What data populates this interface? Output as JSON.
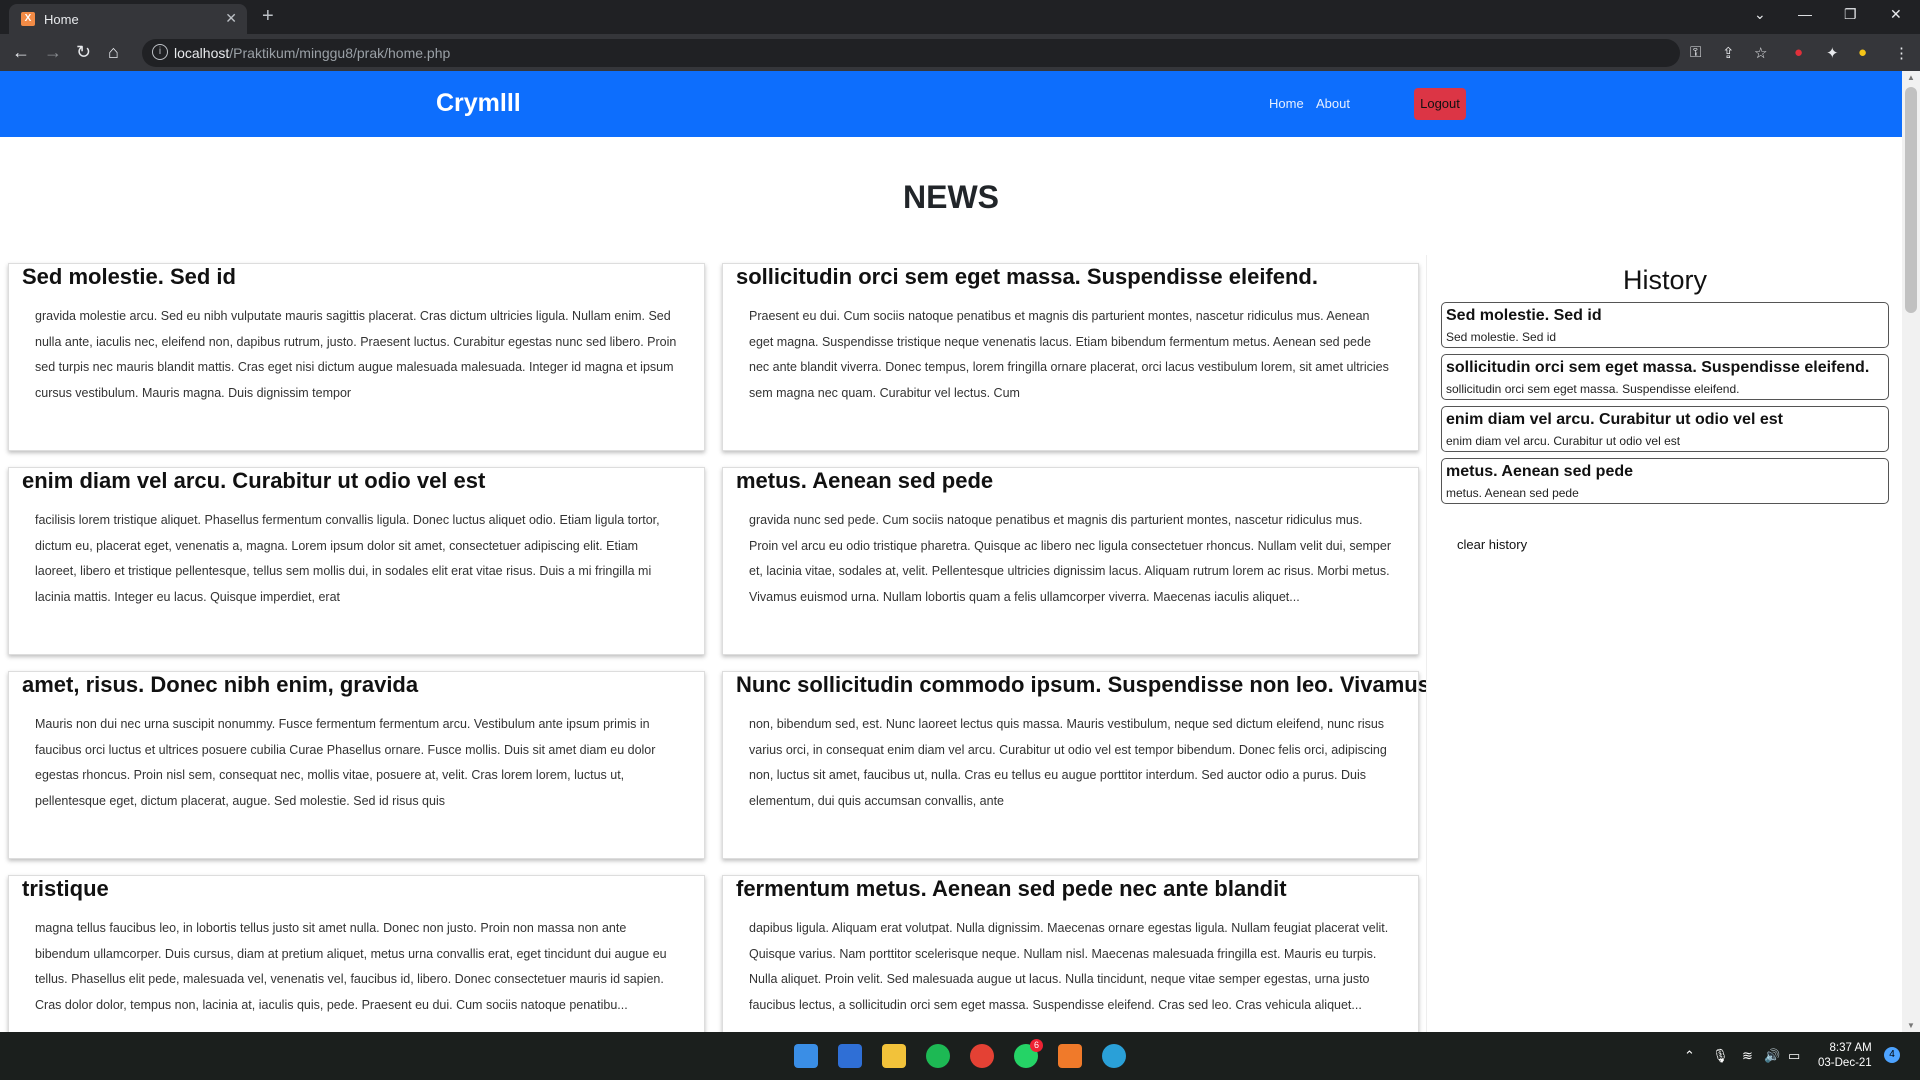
{
  "browser": {
    "tab_title": "Home",
    "url_host": "localhost",
    "url_path": "/Praktikum/minggu8/prak/home.php"
  },
  "navbar": {
    "brand": "Crymlll",
    "links": [
      "Home",
      "About"
    ],
    "logout": "Logout"
  },
  "main": {
    "heading": "NEWS",
    "cards": [
      {
        "title": "Sed molestie. Sed id",
        "body": "gravida molestie arcu. Sed eu nibh vulputate mauris sagittis placerat. Cras dictum ultricies ligula. Nullam enim. Sed nulla ante, iaculis nec, eleifend non, dapibus rutrum, justo. Praesent luctus. Curabitur egestas nunc sed libero. Proin sed turpis nec mauris blandit mattis. Cras eget nisi dictum augue malesuada malesuada. Integer id magna et ipsum cursus vestibulum. Mauris magna. Duis dignissim tempor"
      },
      {
        "title": "sollicitudin orci sem eget massa. Suspendisse eleifend.",
        "body": "Praesent eu dui. Cum sociis natoque penatibus et magnis dis parturient montes, nascetur ridiculus mus. Aenean eget magna. Suspendisse tristique neque venenatis lacus. Etiam bibendum fermentum metus. Aenean sed pede nec ante blandit viverra. Donec tempus, lorem fringilla ornare placerat, orci lacus vestibulum lorem, sit amet ultricies sem magna nec quam. Curabitur vel lectus. Cum"
      },
      {
        "title": "enim diam vel arcu. Curabitur ut odio vel est",
        "body": "facilisis lorem tristique aliquet. Phasellus fermentum convallis ligula. Donec luctus aliquet odio. Etiam ligula tortor, dictum eu, placerat eget, venenatis a, magna. Lorem ipsum dolor sit amet, consectetuer adipiscing elit. Etiam laoreet, libero et tristique pellentesque, tellus sem mollis dui, in sodales elit erat vitae risus. Duis a mi fringilla mi lacinia mattis. Integer eu lacus. Quisque imperdiet, erat"
      },
      {
        "title": "metus. Aenean sed pede",
        "body": "gravida nunc sed pede. Cum sociis natoque penatibus et magnis dis parturient montes, nascetur ridiculus mus. Proin vel arcu eu odio tristique pharetra. Quisque ac libero nec ligula consectetuer rhoncus. Nullam velit dui, semper et, lacinia vitae, sodales at, velit. Pellentesque ultricies dignissim lacus. Aliquam rutrum lorem ac risus. Morbi metus. Vivamus euismod urna. Nullam lobortis quam a felis ullamcorper viverra. Maecenas iaculis aliquet..."
      },
      {
        "title": "amet, risus. Donec nibh enim, gravida",
        "body": "Mauris non dui nec urna suscipit nonummy. Fusce fermentum fermentum arcu. Vestibulum ante ipsum primis in faucibus orci luctus et ultrices posuere cubilia Curae Phasellus ornare. Fusce mollis. Duis sit amet diam eu dolor egestas rhoncus. Proin nisl sem, consequat nec, mollis vitae, posuere at, velit. Cras lorem lorem, luctus ut, pellentesque eget, dictum placerat, augue. Sed molestie. Sed id risus quis"
      },
      {
        "title": "Nunc sollicitudin commodo ipsum. Suspendisse non leo. Vivamus",
        "body": "non, bibendum sed, est. Nunc laoreet lectus quis massa. Mauris vestibulum, neque sed dictum eleifend, nunc risus varius orci, in consequat enim diam vel arcu. Curabitur ut odio vel est tempor bibendum. Donec felis orci, adipiscing non, luctus sit amet, faucibus ut, nulla. Cras eu tellus eu augue porttitor interdum. Sed auctor odio a purus. Duis elementum, dui quis accumsan convallis, ante"
      },
      {
        "title": "tristique",
        "body": "magna tellus faucibus leo, in lobortis tellus justo sit amet nulla. Donec non justo. Proin non massa non ante bibendum ullamcorper. Duis cursus, diam at pretium aliquet, metus urna convallis erat, eget tincidunt dui augue eu tellus. Phasellus elit pede, malesuada vel, venenatis vel, faucibus id, libero. Donec consectetuer mauris id sapien. Cras dolor dolor, tempus non, lacinia at, iaculis quis, pede. Praesent eu dui. Cum sociis natoque penatibu..."
      },
      {
        "title": "fermentum metus. Aenean sed pede nec ante blandit",
        "body": "dapibus ligula. Aliquam erat volutpat. Nulla dignissim. Maecenas ornare egestas ligula. Nullam feugiat placerat velit. Quisque varius. Nam porttitor scelerisque neque. Nullam nisl. Maecenas malesuada fringilla est. Mauris eu turpis. Nulla aliquet. Proin velit. Sed malesuada augue ut lacus. Nulla tincidunt, neque vitae semper egestas, urna justo faucibus lectus, a sollicitudin orci sem eget massa. Suspendisse eleifend. Cras sed leo. Cras vehicula aliquet..."
      }
    ]
  },
  "sidebar": {
    "title": "History",
    "items": [
      {
        "title": "Sed molestie. Sed id",
        "sub": "Sed molestie. Sed id"
      },
      {
        "title": "sollicitudin orci sem eget massa. Suspendisse eleifend.",
        "sub": "sollicitudin orci sem eget massa. Suspendisse eleifend."
      },
      {
        "title": "enim diam vel arcu. Curabitur ut odio vel est",
        "sub": "enim diam vel arcu. Curabitur ut odio vel est"
      },
      {
        "title": "metus. Aenean sed pede",
        "sub": "metus. Aenean sed pede"
      }
    ],
    "clear": "clear history"
  },
  "taskbar": {
    "time": "8:37 AM",
    "date": "03-Dec-21",
    "whatsapp_badge": "6",
    "notifications": "4"
  },
  "colors": {
    "navbar": "#0d6efd",
    "logout": "#dc3545"
  }
}
